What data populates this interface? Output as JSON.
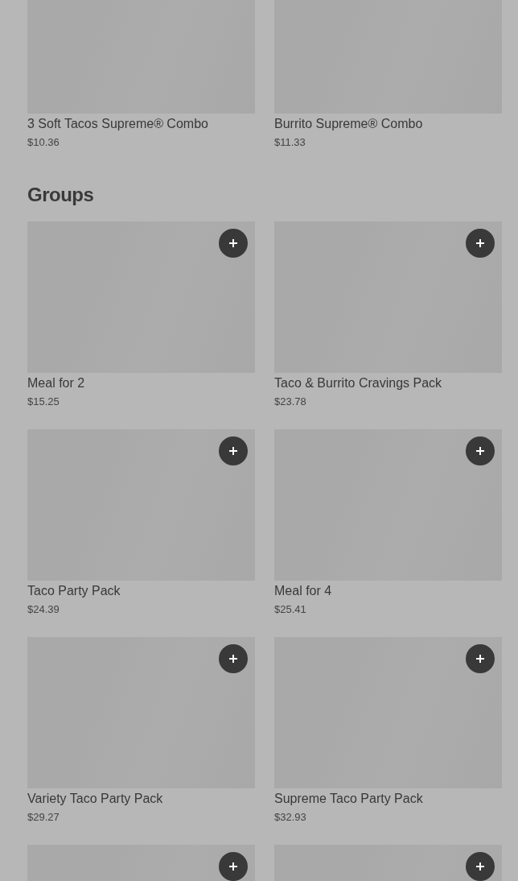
{
  "top_items": [
    {
      "name": "3 Soft Tacos Supreme® Combo",
      "price": "$10.36",
      "add_button": false
    },
    {
      "name": "Burrito Supreme® Combo",
      "price": "$11.33",
      "add_button": false
    }
  ],
  "groups": {
    "title": "Groups",
    "items": [
      {
        "name": "Meal for 2",
        "price": "$15.25",
        "add_button": true
      },
      {
        "name": "Taco & Burrito Cravings Pack",
        "price": "$23.78",
        "add_button": true
      },
      {
        "name": "Taco Party Pack",
        "price": "$24.39",
        "add_button": true
      },
      {
        "name": "Meal for 4",
        "price": "$25.41",
        "add_button": true
      },
      {
        "name": "Variety Taco Party Pack",
        "price": "$29.27",
        "add_button": true
      },
      {
        "name": "Supreme Taco Party Pack",
        "price": "$32.93",
        "add_button": true
      },
      {
        "add_button": true
      },
      {
        "add_button": true
      }
    ]
  }
}
